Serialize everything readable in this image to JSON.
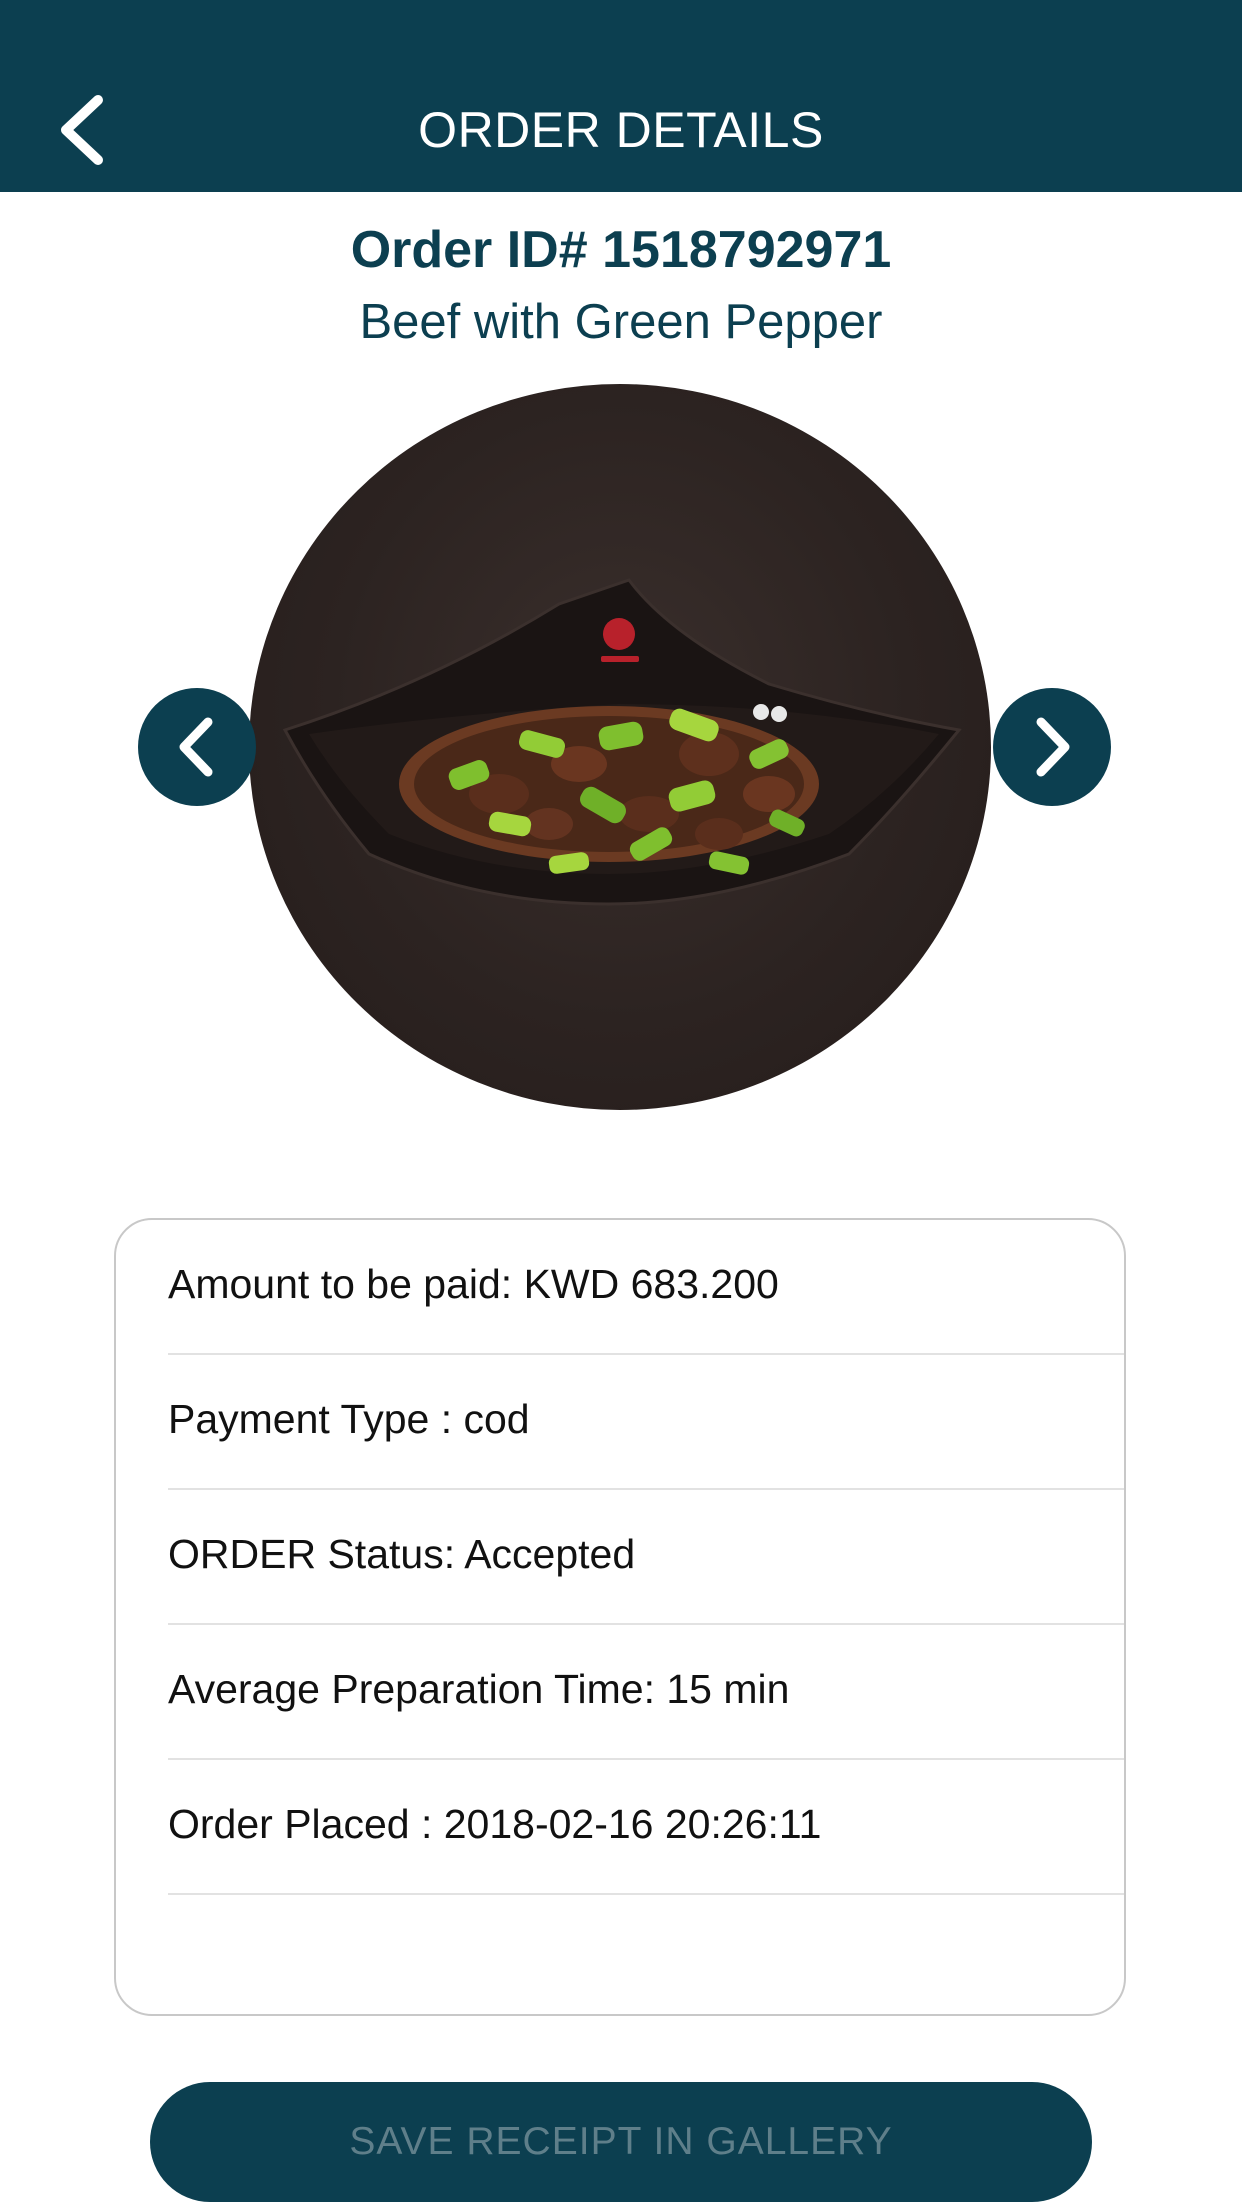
{
  "header": {
    "title": "ORDER DETAILS",
    "back_icon": "chevron-left-icon",
    "background_color": "#0c3f50"
  },
  "order": {
    "id_label": "Order ID# 1518792971",
    "item_name": "Beef with Green Pepper"
  },
  "gallery": {
    "prev_icon": "chevron-left-icon",
    "next_icon": "chevron-right-icon",
    "image_description_icon": "food-photo"
  },
  "details": [
    {
      "text": "Amount to be paid: KWD 683.200"
    },
    {
      "text": "Payment Type : cod"
    },
    {
      "text": "ORDER Status: Accepted"
    },
    {
      "text": "Average Preparation Time: 15 min"
    },
    {
      "text": "Order Placed : 2018-02-16 20:26:11"
    }
  ],
  "actions": {
    "save_receipt_label": "SAVE RECEIPT IN GALLERY"
  },
  "colors": {
    "primary": "#0c3f50",
    "text_dark": "#111111",
    "button_text_disabled": "#5f7f8a"
  }
}
